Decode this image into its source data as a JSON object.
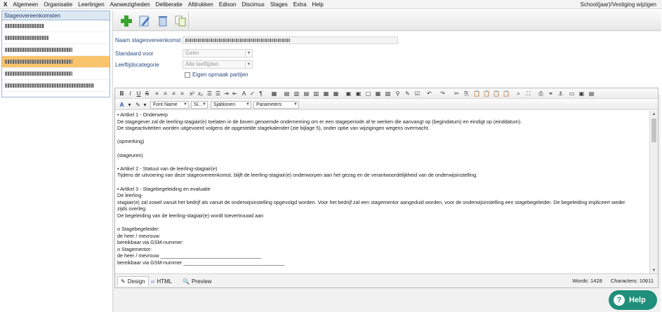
{
  "menubar": {
    "close": "X",
    "items": [
      "Algemeen",
      "Organisatie",
      "Leerlingen",
      "Aanwezigheden",
      "Deliberatie",
      "Afdrukken",
      "Edison",
      "Discimus",
      "Stages",
      "Extra",
      "Help"
    ],
    "right": "School(jaar)/Vestiging wijzigen"
  },
  "leftpanel": {
    "title": "Stageovereenkomsten",
    "items": [
      {
        "width": 56,
        "selected": false
      },
      {
        "width": 62,
        "selected": false
      },
      {
        "width": 96,
        "selected": false
      },
      {
        "width": 96,
        "selected": true
      },
      {
        "width": 96,
        "selected": false
      },
      {
        "width": 127,
        "selected": false
      }
    ]
  },
  "form": {
    "name_label": "Naam stageovereenkomst",
    "standard_label": "Standaard voor",
    "standard_value": "Geen",
    "age_label": "Leeftijdscategorie",
    "age_value": "Alle leeftijden",
    "checkbox_label": "Eigen opmaak partijen"
  },
  "editor": {
    "font_name": "Font Name",
    "font_size": "Si...",
    "templates": "Sjablonen",
    "parameters": "Parameters",
    "tabs": {
      "design": "Design",
      "html": "HTML",
      "preview": "Preview"
    },
    "words": "Words: 1428",
    "characters": "Characters: 10611",
    "lines": [
      "•   Artikel 1 - Onderwerp",
      "De stagegever zal de leerling-stagiair(e) toelaten in de boven genoemde onderneming om er een stageperiode af te werken die aanvangt op (begindatum) en eindigt op (einddatum).",
      "De stageactiviteiten worden uitgevoerd volgens de opgestelde stagekalender (zie bijlage 5), onder optie van wijzigingen wegens overmacht.",
      "",
      "(opmerking)",
      "",
      "(stageuren)",
      "",
      "•   Artikel 2 - Statuut van de leerling-stagiair(e)",
      "Tijdens de uitvoering van deze stageovereenkomst, blijft de leerling-stagiair(e) onderworpen aan het gezag en de verantwoordelijkheid van de onderwijsinstelling.",
      "",
      "•   Artikel 3 - Stagebegeleiding en evaluatie",
      "De leerling-",
      "stagiair(e) zal zowel vanuit het bedrijf als vanuit de onderwijsinstelling opgevolgd worden. Voor het bedrijf zal een stagementor aangeduid worden, voor de onderwijsinstelling een stagebegeleider. De begeleiding impliceert weder",
      "zijds overleg.",
      "De begeleiding van de leerling-stagiair(e) wordt toevertrouwd aan",
      "",
      "o     Stagebegeleider:",
      "        de heer / mevrouw:",
      "        bereikbaar via GSM-nummer:",
      "o     Stagementor:",
      "        de heer / mevrouw ____________________________________",
      "        bereikbaar via GSM-nummer ____________________________________"
    ]
  },
  "help": {
    "label": "Help",
    "icon": "?"
  },
  "colors": {
    "accent": "#1f8e7a",
    "selected": "#f9c46b",
    "label": "#2b4d84"
  }
}
